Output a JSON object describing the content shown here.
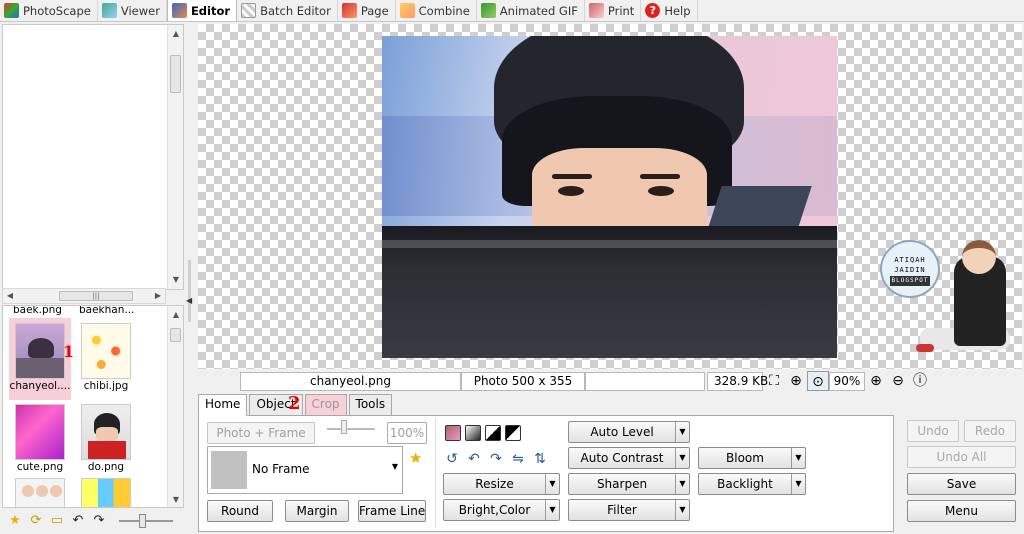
{
  "tabs": [
    {
      "label": "PhotoScape",
      "icon": "photoscape-icon"
    },
    {
      "label": "Viewer",
      "icon": "viewer-icon"
    },
    {
      "label": "Editor",
      "icon": "editor-icon"
    },
    {
      "label": "Batch Editor",
      "icon": "batch-editor-icon"
    },
    {
      "label": "Page",
      "icon": "page-icon"
    },
    {
      "label": "Combine",
      "icon": "combine-icon"
    },
    {
      "label": "Animated GIF",
      "icon": "animated-gif-icon"
    },
    {
      "label": "Print",
      "icon": "print-icon"
    },
    {
      "label": "Help",
      "icon": "help-icon"
    }
  ],
  "thumbnails": {
    "partial_top": [
      "baek.png",
      "baekhan..."
    ],
    "items": [
      {
        "name": "chanyeol....",
        "selected": true
      },
      {
        "name": "chibi.jpg",
        "selected": false
      },
      {
        "name": "cute.png",
        "selected": false
      },
      {
        "name": "do.png",
        "selected": false
      }
    ]
  },
  "annotations": {
    "one": "1",
    "two": "2"
  },
  "sticker": {
    "line1": "ATIQAH",
    "line2": "JAIDIN",
    "line3": "BLOGSPOT"
  },
  "status": {
    "filename": "chanyeol.png",
    "photo_size": "Photo 500 x 355",
    "file_size": "328.9 KB",
    "zoom": "90%"
  },
  "editor": {
    "tabs": [
      "Home",
      "Object",
      "Crop",
      "Tools"
    ],
    "photo_frame_label": "Photo + Frame",
    "frame_percent": "100%",
    "frame_value": "No Frame",
    "round_label": "Round",
    "margin_label": "Margin",
    "frameline_label": "Frame Line",
    "resize_label": "Resize",
    "bright_label": "Bright,Color",
    "auto_level_label": "Auto Level",
    "auto_contrast_label": "Auto Contrast",
    "sharpen_label": "Sharpen",
    "filter_label": "Filter",
    "bloom_label": "Bloom",
    "backlight_label": "Backlight"
  },
  "right_buttons": {
    "undo": "Undo",
    "redo": "Redo",
    "undo_all": "Undo All",
    "save": "Save",
    "menu": "Menu"
  }
}
